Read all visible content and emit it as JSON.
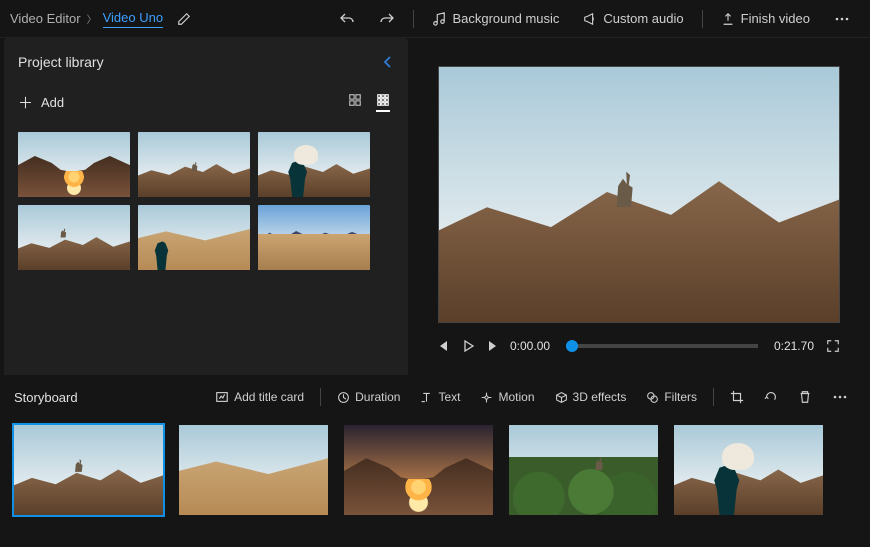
{
  "header": {
    "root": "Video Editor",
    "project": "Video Uno",
    "actions": {
      "bg_music": "Background music",
      "custom_audio": "Custom audio",
      "finish": "Finish video"
    }
  },
  "library": {
    "title": "Project library",
    "add_label": "Add",
    "thumbs": [
      {
        "id": "arch"
      },
      {
        "id": "goat-jump"
      },
      {
        "id": "llama-person"
      },
      {
        "id": "goat-ridge"
      },
      {
        "id": "dune-person"
      },
      {
        "id": "desert-plain"
      }
    ]
  },
  "preview": {
    "time_current": "0:00.00",
    "time_total": "0:21.70"
  },
  "storyboard": {
    "title": "Storyboard",
    "actions": {
      "title_card": "Add title card",
      "duration": "Duration",
      "text": "Text",
      "motion": "Motion",
      "threed": "3D effects",
      "filters": "Filters"
    },
    "clips": [
      {
        "id": "goat-ridge",
        "selected": true
      },
      {
        "id": "dune-person",
        "selected": false
      },
      {
        "id": "arch",
        "selected": false
      },
      {
        "id": "bush-goat",
        "selected": false
      },
      {
        "id": "llama-person",
        "selected": false
      }
    ]
  }
}
